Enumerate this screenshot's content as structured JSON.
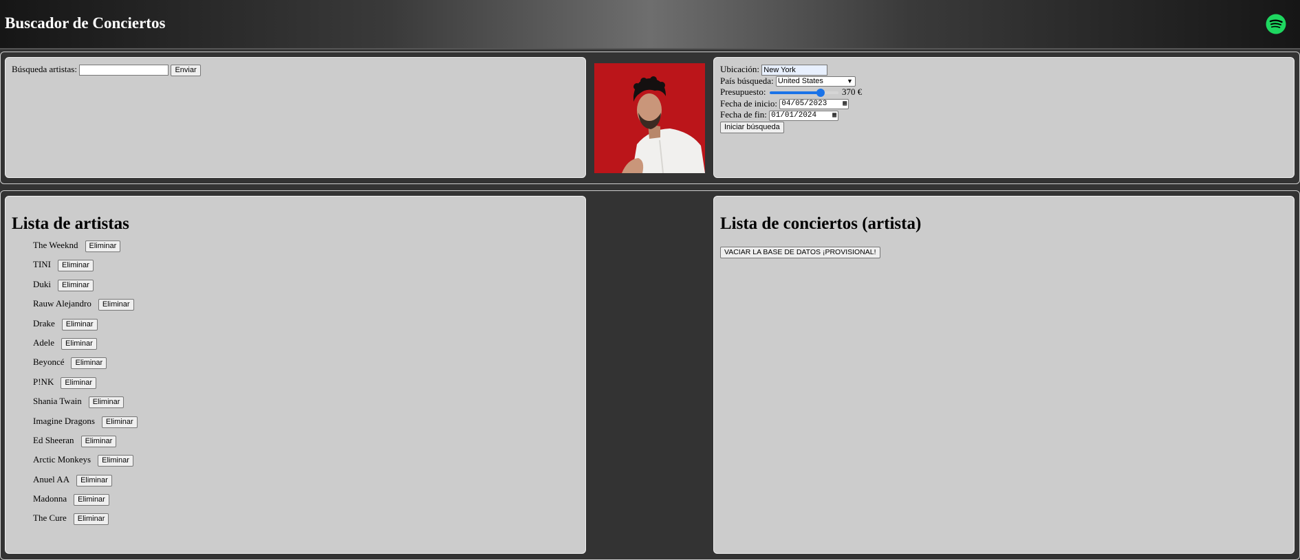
{
  "header": {
    "title": "Buscador de Conciertos",
    "logo_icon": "spotify-icon",
    "logo_color": "#1ed760"
  },
  "search": {
    "label": "Búsqueda artistas:",
    "value": "",
    "submit_label": "Enviar"
  },
  "filters": {
    "location_label": "Ubicación:",
    "location_value": "New York",
    "country_label": "País búsqueda:",
    "country_value": "United States",
    "budget_label": "Presupuesto:",
    "budget_value": "370 €",
    "budget_fraction": 0.74,
    "start_label": "Fecha de inicio:",
    "start_value": "04/05/2023",
    "end_label": "Fecha de fin:",
    "end_value": "01/01/2024",
    "submit_label": "Iniciar búsqueda"
  },
  "artists": {
    "title": "Lista de artistas",
    "remove_label": "Eliminar",
    "items": [
      "The Weeknd",
      "TINI",
      "Duki",
      "Rauw Alejandro",
      "Drake",
      "Adele",
      "Beyoncé",
      "P!NK",
      "Shania Twain",
      "Imagine Dragons",
      "Ed Sheeran",
      "Arctic Monkeys",
      "Anuel AA",
      "Madonna",
      "The Cure"
    ]
  },
  "concerts": {
    "title": "Lista de conciertos (artista)",
    "clear_label": "VACIAR LA BASE DE DATOS ¡PROVISIONAL!"
  },
  "colors": {
    "accent": "#1a73e8",
    "panel": "#cccccc",
    "background": "#333333",
    "photo_bg": "#c0171b"
  }
}
